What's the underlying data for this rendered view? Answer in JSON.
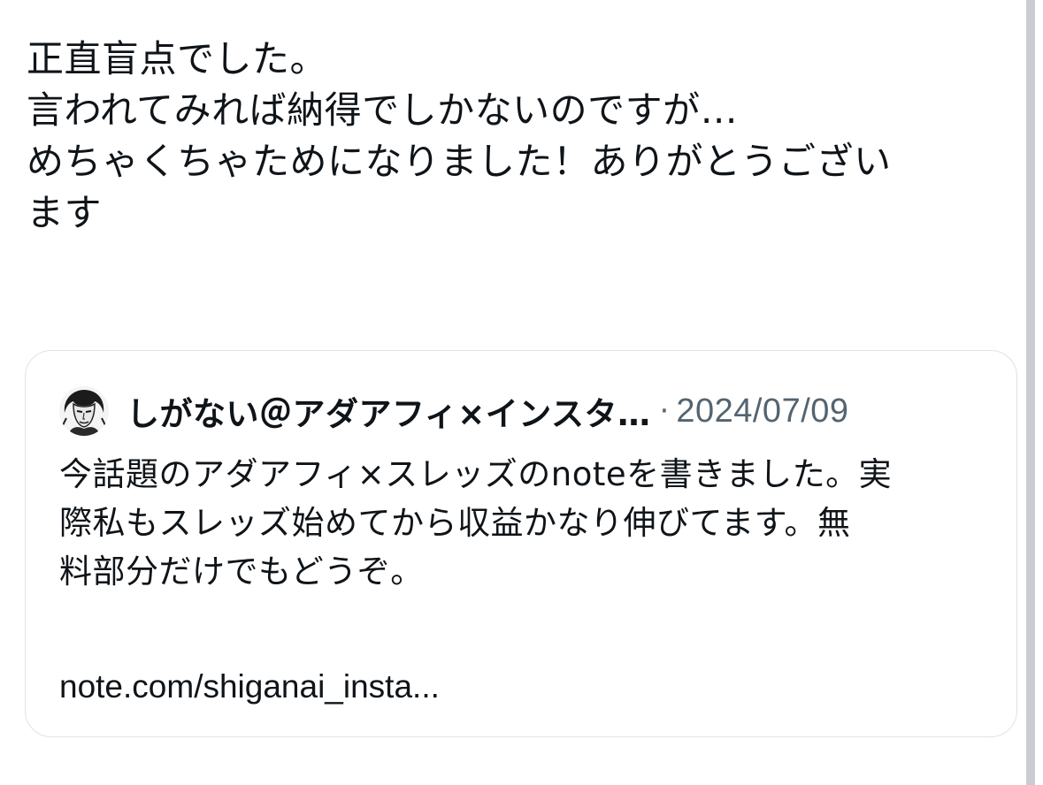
{
  "post": {
    "lines": [
      "正直盲点でした。",
      "言われてみれば納得でしかないのですが…",
      "めちゃくちゃためになりました！ありがとうござい",
      "ます"
    ]
  },
  "quote": {
    "author": "しがない＠アダアフィ×インスタ…",
    "separator": "·",
    "date": "2024/07/09",
    "body_lines": [
      "今話題のアダアフィ×スレッズのnoteを書きました。実",
      "際私もスレッズ始めてから収益かなり伸びてます。無",
      "料部分だけでもどうぞ。"
    ],
    "link": "note.com/shiganai_insta..."
  },
  "colors": {
    "text": "#0f1419",
    "secondary": "#536471",
    "border": "#dfe3e7",
    "scrollbar": "#c9cdd1"
  }
}
